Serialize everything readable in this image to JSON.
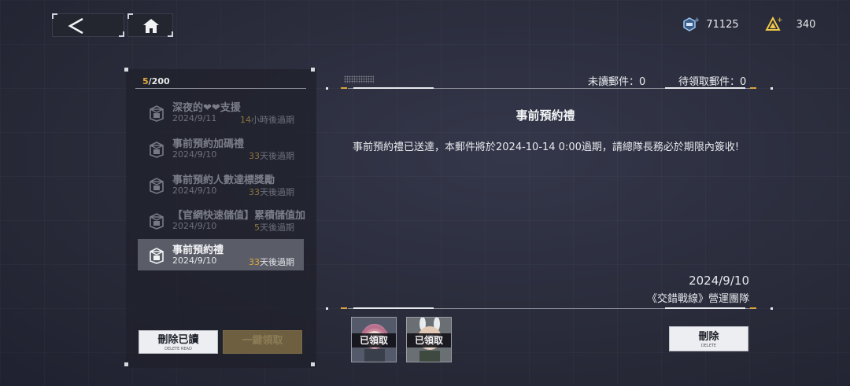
{
  "topbar": {
    "back_icon": "chevron-left-icon",
    "home_icon": "home-icon",
    "currency1": {
      "icon": "gem-plus-icon",
      "value": "71125"
    },
    "currency2": {
      "icon": "stamina-plus-icon",
      "value": "340"
    }
  },
  "mailbox": {
    "count_current": "5",
    "count_total": "/200",
    "items": [
      {
        "title": "深夜的❤❤支援",
        "date": "2024/9/11",
        "exp_num": "14",
        "exp_unit": "小時後過期",
        "state": "read"
      },
      {
        "title": "事前預約加碼禮",
        "date": "2024/9/10",
        "exp_num": "33",
        "exp_unit": "天後過期",
        "state": "read"
      },
      {
        "title": "事前預約人數達標獎勵",
        "date": "2024/9/10",
        "exp_num": "33",
        "exp_unit": "天後過期",
        "state": "read"
      },
      {
        "title": "【官網快速儲值】累積儲值加",
        "date": "2024/9/10",
        "exp_num": "5",
        "exp_unit": "天後過期",
        "state": "read"
      },
      {
        "title": "事前預約禮",
        "date": "2024/9/10",
        "exp_num": "33",
        "exp_unit": "天後過期",
        "state": "selected"
      }
    ],
    "delete_read_label": "刪除已讀",
    "delete_read_sub": "DELETE READ",
    "claim_all_label": "一鍵領取"
  },
  "stats": {
    "unread_label": "未讀郵件：0",
    "unclaimed_label": "待領取郵件：0"
  },
  "mail": {
    "title": "事前預約禮",
    "body": "事前預約禮已送達，本郵件將於2024-10-14 0:00過期，請總隊長務必於期限內簽收!",
    "sign_date": "2024/9/10",
    "sign_team": "《交錯戰線》營運團隊",
    "rewards": [
      {
        "status": "已領取",
        "avatar": "character-portrait-pink-hair"
      },
      {
        "status": "已領取",
        "avatar": "character-portrait-bunny-ears"
      }
    ],
    "delete_label": "刪除",
    "delete_sub": "DELETE"
  },
  "colors": {
    "accent": "#e3a93a",
    "selected_bg": "#5a5d68",
    "button_light": "#eceef1"
  }
}
